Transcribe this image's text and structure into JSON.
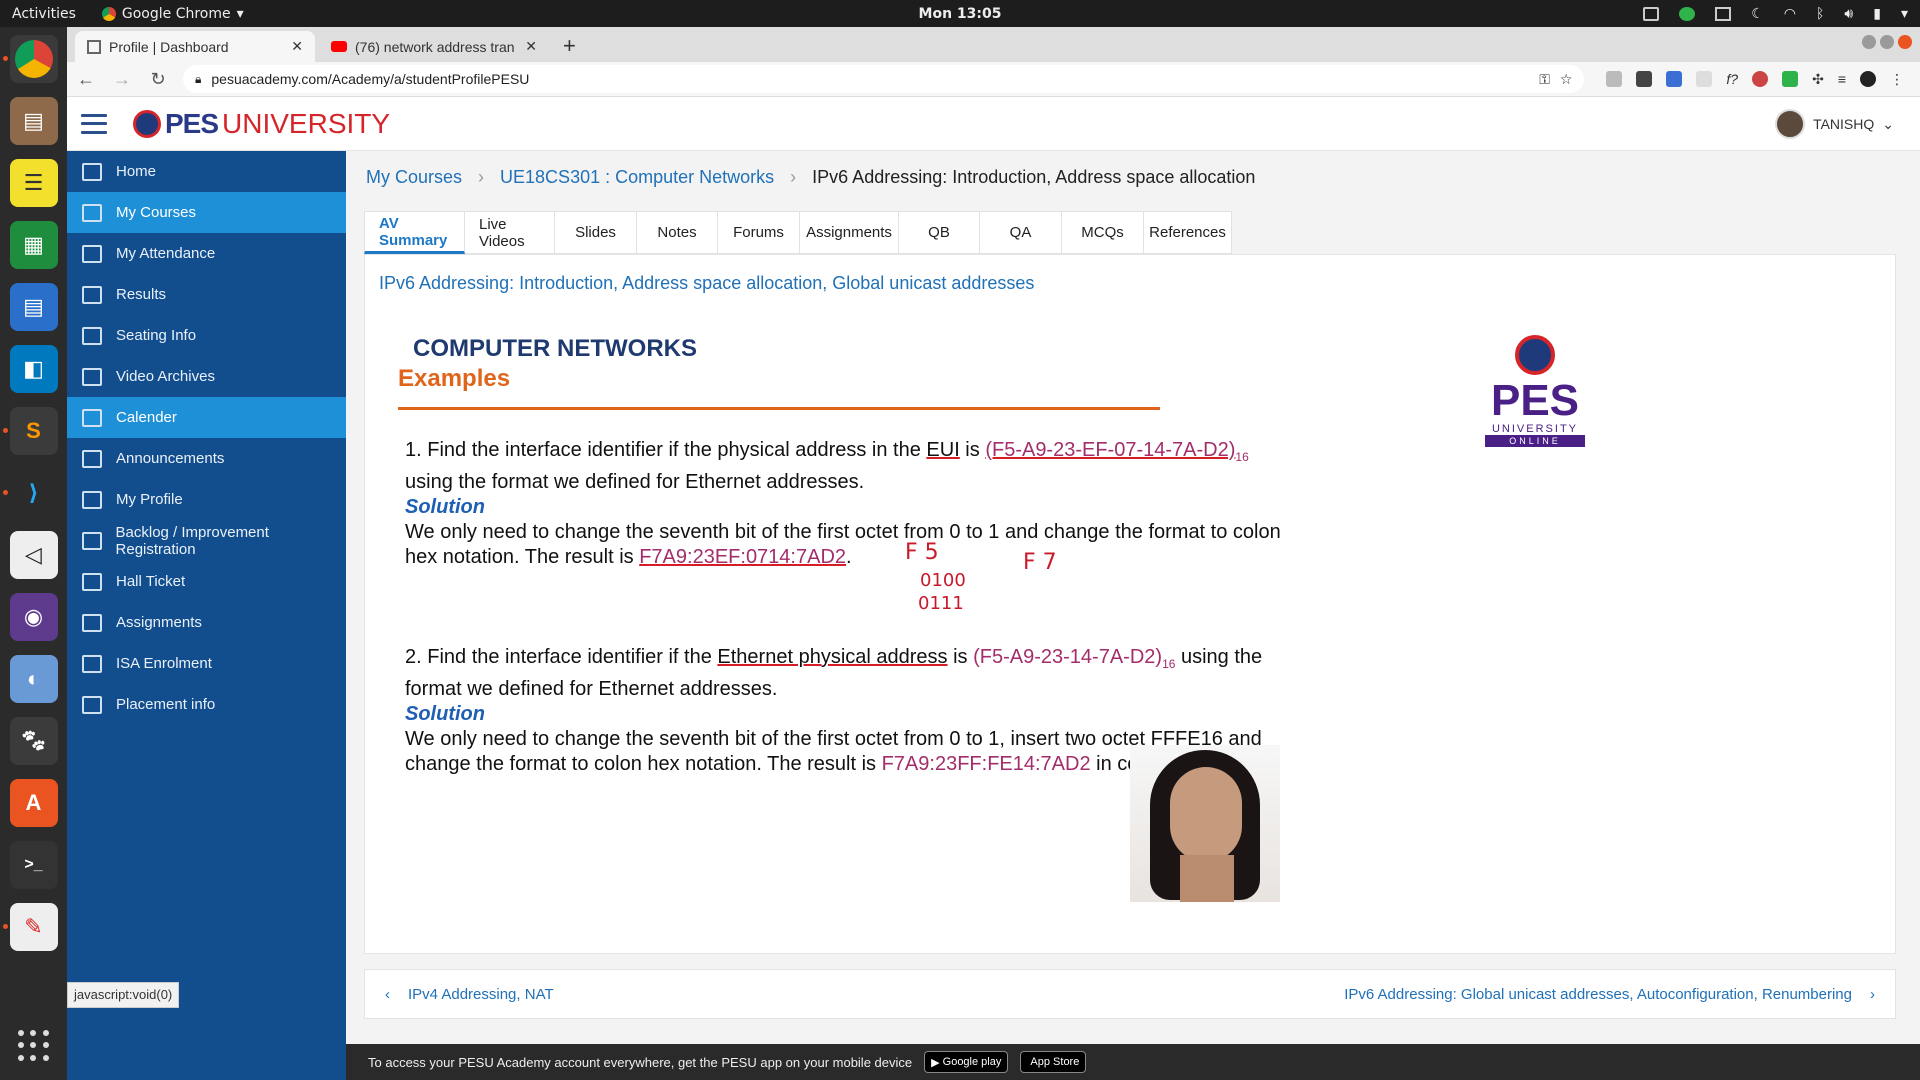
{
  "os": {
    "activities": "Activities",
    "app_menu": "Google Chrome",
    "clock": "Mon 13:05"
  },
  "browser": {
    "tabs": [
      {
        "title": "Profile | Dashboard",
        "active": true
      },
      {
        "title": "(76) network address tran",
        "active": false
      }
    ],
    "url": "pesuacademy.com/Academy/a/studentProfilePESU",
    "status_text": "javascript:void(0)"
  },
  "site": {
    "logo_pes": "PES",
    "logo_university": "UNIVERSITY",
    "user_name": "TANISHQ",
    "sidebar": [
      {
        "label": "Home",
        "icon": "home-icon",
        "active": false
      },
      {
        "label": "My Courses",
        "icon": "layers-icon",
        "active": true
      },
      {
        "label": "My Attendance",
        "icon": "calendar-grid-icon",
        "active": false
      },
      {
        "label": "Results",
        "icon": "document-icon",
        "active": false
      },
      {
        "label": "Seating Info",
        "icon": "monitor-icon",
        "active": false
      },
      {
        "label": "Video Archives",
        "icon": "video-icon",
        "active": false
      },
      {
        "label": "Calender",
        "icon": "calendar-icon",
        "active": true
      },
      {
        "label": "Announcements",
        "icon": "megaphone-icon",
        "active": false
      },
      {
        "label": "My Profile",
        "icon": "user-icon",
        "active": false
      },
      {
        "label": "Backlog / Improvement Registration",
        "icon": "layers-icon",
        "active": false
      },
      {
        "label": "Hall Ticket",
        "icon": "download-icon",
        "active": false
      },
      {
        "label": "Assignments",
        "icon": "document-icon",
        "active": false
      },
      {
        "label": "ISA Enrolment",
        "icon": "document-icon",
        "active": false
      },
      {
        "label": "Placement info",
        "icon": "user-icon",
        "active": false
      }
    ],
    "breadcrumb": {
      "root": "My Courses",
      "course": "UE18CS301 : Computer Networks",
      "current": "IPv6 Addressing: Introduction, Address space allocation"
    },
    "tabs": [
      "AV Summary",
      "Live Videos",
      "Slides",
      "Notes",
      "Forums",
      "Assignments",
      "QB",
      "QA",
      "MCQs",
      "References"
    ],
    "content_title": "IPv6 Addressing: Introduction, Address space allocation, Global unicast addresses",
    "slide": {
      "heading": "COMPUTER NETWORKS",
      "subheading": "Examples",
      "q1_pre": "1. Find the interface identifier if the physical address in the ",
      "q1_eui": "EUI",
      "q1_is": " is ",
      "q1_hex": "(F5-A9-23-EF-07-14-7A-D2)",
      "q1_sub": "16",
      "q1_post": "using the format we defined for Ethernet addresses.",
      "solution": "Solution",
      "a1_pre": "We only need to change the seventh bit of the first octet from 0 to 1 and change the format to colon hex notation. The result is ",
      "a1_hex": "F7A9:23EF:0714:7AD2",
      "a1_post": ".",
      "q2_pre": "2. Find the interface identifier if the ",
      "q2_eth": "Ethernet physical address",
      "q2_is": " is ",
      "q2_hex": "(F5-A9-23-14-7A-D2)",
      "q2_sub": "16",
      "q2_post": " using the format we defined for Ethernet addresses.",
      "a2_pre": "We only need to change the seventh bit of the first octet from 0 to 1, insert two octet FFFE16 and change the format to colon hex notation. The result is ",
      "a2_hex": "F7A9:23FF:FE14:7AD2",
      "a2_post": " in colon hex.",
      "ink_f5": "F 5",
      "ink_f7": "F 7",
      "ink_bits1": "0100",
      "ink_bits2": "0111",
      "logo_pes": "PES",
      "logo_university": "UNIVERSITY",
      "logo_online": "ONLINE"
    },
    "prev_link": "IPv4 Addressing, NAT",
    "next_link": "IPv6 Addressing: Global unicast addresses, Autoconfiguration, Renumbering",
    "app_promo": "To access your PESU Academy account everywhere, get the PESU app on your mobile device",
    "google_play": "Google play",
    "app_store": "App Store"
  },
  "colors": {
    "sidebar_bg": "#124e8e",
    "sidebar_active": "#1e90d8",
    "link_blue": "#2071b8",
    "slide_orange": "#e0651b",
    "hex_magenta": "#a32d6a"
  }
}
